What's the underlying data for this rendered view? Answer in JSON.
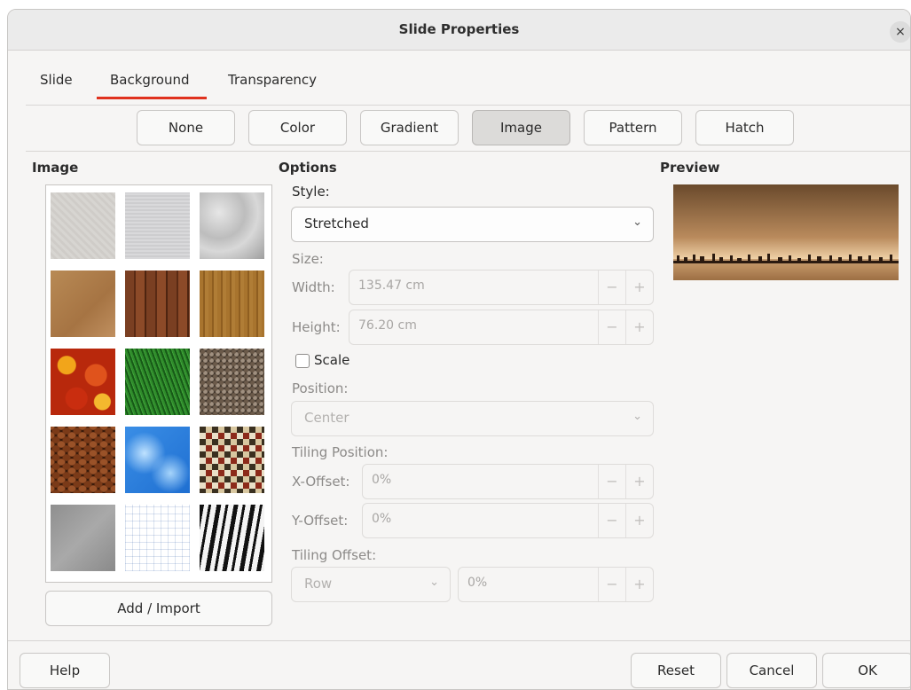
{
  "window": {
    "title": "Slide Properties",
    "close_glyph": "×"
  },
  "tabs": [
    {
      "label": "Slide"
    },
    {
      "label": "Background",
      "active": true
    },
    {
      "label": "Transparency"
    }
  ],
  "fill_buttons": [
    {
      "label": "None"
    },
    {
      "label": "Color"
    },
    {
      "label": "Gradient"
    },
    {
      "label": "Image",
      "active": true
    },
    {
      "label": "Pattern"
    },
    {
      "label": "Hatch"
    }
  ],
  "image_section": {
    "heading": "Image",
    "thumbnails": [
      "painted-white-texture",
      "paper-texture",
      "paper-crumpled-texture",
      "parchment-paper-texture",
      "fence-wood-texture",
      "wooden-board-texture",
      "maple-leaves-texture",
      "grass-texture",
      "pebbles-texture",
      "coffee-beans-texture",
      "sky-clouds-texture",
      "color-stripes-texture",
      "concrete-texture",
      "paper-graph-texture",
      "zebra-texture"
    ],
    "add_import_label": "Add / Import"
  },
  "options": {
    "heading": "Options",
    "style_label": "Style:",
    "style_value": "Stretched",
    "size_label": "Size:",
    "width_label": "Width:",
    "width_value": "135.47 cm",
    "height_label": "Height:",
    "height_value": "76.20 cm",
    "scale_label": "Scale",
    "scale_checked": false,
    "position_label": "Position:",
    "position_value": "Center",
    "tiling_position_label": "Tiling Position:",
    "x_offset_label": "X-Offset:",
    "x_offset_value": "0%",
    "y_offset_label": "Y-Offset:",
    "y_offset_value": "0%",
    "tiling_offset_label": "Tiling Offset:",
    "tiling_offset_mode": "Row",
    "tiling_offset_value": "0%",
    "minus_glyph": "−",
    "plus_glyph": "+",
    "chevron_glyph": "⌄"
  },
  "preview": {
    "heading": "Preview"
  },
  "footer": {
    "help_label": "Help",
    "reset_label": "Reset",
    "cancel_label": "Cancel",
    "ok_label": "OK"
  },
  "colors": {
    "accent_underline": "#e0321e",
    "dialog_bg": "#f6f5f4"
  }
}
